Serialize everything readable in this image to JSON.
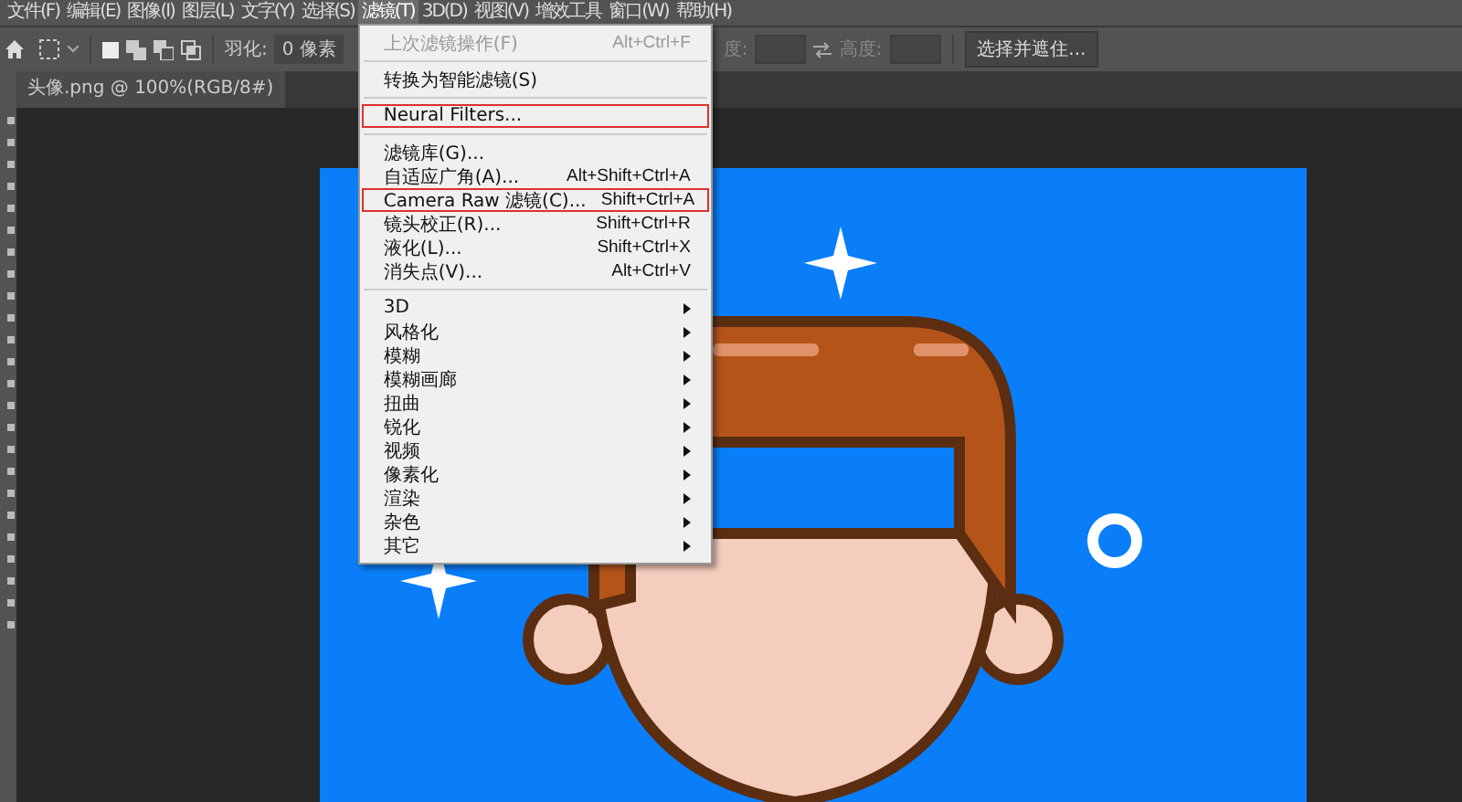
{
  "menubar": [
    {
      "label": "文件(F)",
      "selected": false
    },
    {
      "label": "编辑(E)",
      "selected": false
    },
    {
      "label": "图像(I)",
      "selected": false
    },
    {
      "label": "图层(L)",
      "selected": false
    },
    {
      "label": "文字(Y)",
      "selected": false
    },
    {
      "label": "选择(S)",
      "selected": false
    },
    {
      "label": "滤镜(T)",
      "selected": true
    },
    {
      "label": "3D(D)",
      "selected": false
    },
    {
      "label": "视图(V)",
      "selected": false
    },
    {
      "label": "增效工具",
      "selected": false
    },
    {
      "label": "窗口(W)",
      "selected": false
    },
    {
      "label": "帮助(H)",
      "selected": false
    }
  ],
  "options_bar": {
    "feather_label": "羽化:",
    "feather_value": "0 像素",
    "width_label": "度:",
    "height_label": "高度:",
    "select_mask_button": "选择并遮住..."
  },
  "document_tab": {
    "title": "头像.png @ 100%(RGB/8#)"
  },
  "filter_menu": [
    {
      "kind": "item",
      "label": "上次滤镜操作(F)",
      "shortcut": "Alt+Ctrl+F",
      "disabled": true,
      "highlighted": false,
      "submenu": false
    },
    {
      "kind": "separator"
    },
    {
      "kind": "item",
      "label": "转换为智能滤镜(S)",
      "disabled": false,
      "highlighted": false,
      "submenu": false
    },
    {
      "kind": "separator"
    },
    {
      "kind": "item",
      "label": "Neural Filters...",
      "disabled": false,
      "highlighted": true,
      "submenu": false
    },
    {
      "kind": "separator"
    },
    {
      "kind": "item",
      "label": "滤镜库(G)...",
      "disabled": false,
      "highlighted": false,
      "submenu": false
    },
    {
      "kind": "item",
      "label": "自适应广角(A)...",
      "shortcut": "Alt+Shift+Ctrl+A",
      "disabled": false,
      "highlighted": false,
      "submenu": false
    },
    {
      "kind": "item",
      "label": "Camera Raw 滤镜(C)...",
      "shortcut": "Shift+Ctrl+A",
      "disabled": false,
      "highlighted": true,
      "submenu": false
    },
    {
      "kind": "item",
      "label": "镜头校正(R)...",
      "shortcut": "Shift+Ctrl+R",
      "disabled": false,
      "highlighted": false,
      "submenu": false
    },
    {
      "kind": "item",
      "label": "液化(L)...",
      "shortcut": "Shift+Ctrl+X",
      "disabled": false,
      "highlighted": false,
      "submenu": false
    },
    {
      "kind": "item",
      "label": "消失点(V)...",
      "shortcut": "Alt+Ctrl+V",
      "disabled": false,
      "highlighted": false,
      "submenu": false
    },
    {
      "kind": "separator"
    },
    {
      "kind": "item",
      "label": "3D",
      "disabled": false,
      "highlighted": false,
      "submenu": true
    },
    {
      "kind": "item",
      "label": "风格化",
      "disabled": false,
      "highlighted": false,
      "submenu": true
    },
    {
      "kind": "item",
      "label": "模糊",
      "disabled": false,
      "highlighted": false,
      "submenu": true
    },
    {
      "kind": "item",
      "label": "模糊画廊",
      "disabled": false,
      "highlighted": false,
      "submenu": true
    },
    {
      "kind": "item",
      "label": "扭曲",
      "disabled": false,
      "highlighted": false,
      "submenu": true
    },
    {
      "kind": "item",
      "label": "锐化",
      "disabled": false,
      "highlighted": false,
      "submenu": true
    },
    {
      "kind": "item",
      "label": "视频",
      "disabled": false,
      "highlighted": false,
      "submenu": true
    },
    {
      "kind": "item",
      "label": "像素化",
      "disabled": false,
      "highlighted": false,
      "submenu": true
    },
    {
      "kind": "item",
      "label": "渲染",
      "disabled": false,
      "highlighted": false,
      "submenu": true
    },
    {
      "kind": "item",
      "label": "杂色",
      "disabled": false,
      "highlighted": false,
      "submenu": true
    },
    {
      "kind": "item",
      "label": "其它",
      "disabled": false,
      "highlighted": false,
      "submenu": true
    }
  ]
}
